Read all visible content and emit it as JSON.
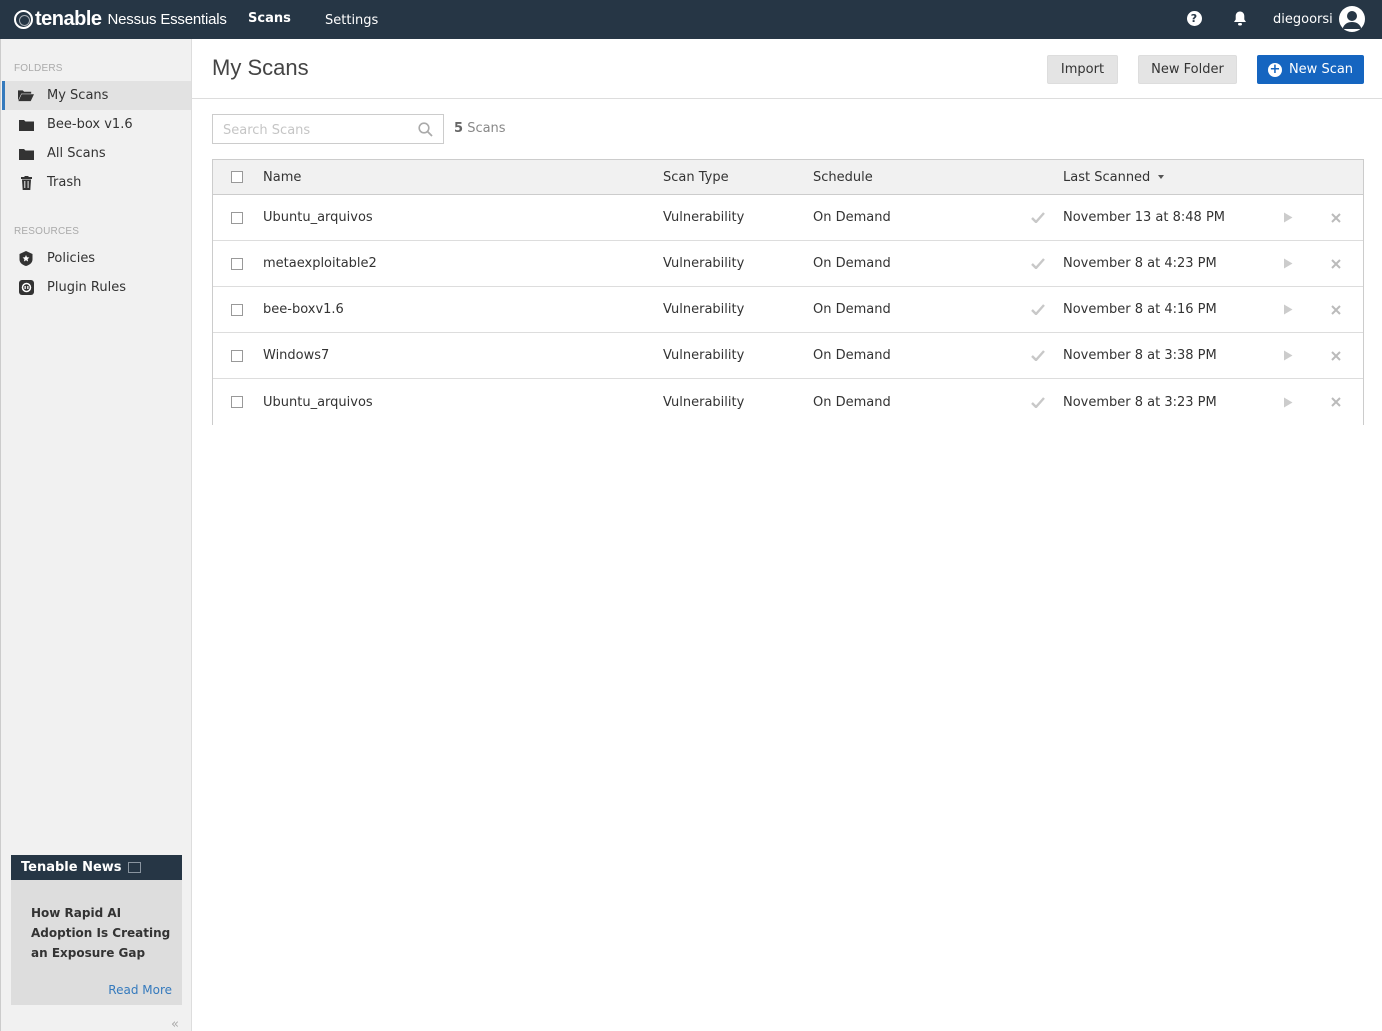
{
  "app": {
    "brand": "tenable",
    "product": "Nessus Essentials"
  },
  "nav": {
    "scans": "Scans",
    "settings": "Settings"
  },
  "user": {
    "name": "diegoorsi"
  },
  "sidebar": {
    "folders_heading": "FOLDERS",
    "folders": [
      {
        "label": "My Scans",
        "icon": "folder-open-icon",
        "active": true
      },
      {
        "label": "Bee-box v1.6",
        "icon": "folder-icon"
      },
      {
        "label": "All Scans",
        "icon": "folder-icon"
      },
      {
        "label": "Trash",
        "icon": "trash-icon"
      }
    ],
    "resources_heading": "RESOURCES",
    "resources": [
      {
        "label": "Policies",
        "icon": "policy-badge-icon"
      },
      {
        "label": "Plugin Rules",
        "icon": "plugin-rules-icon"
      }
    ]
  },
  "news": {
    "title": "Tenable News",
    "headline": "How Rapid AI Adoption Is Creating an Exposure Gap",
    "read_more": "Read More"
  },
  "main": {
    "title": "My Scans",
    "import_label": "Import",
    "new_folder_label": "New Folder",
    "new_scan_label": "New Scan",
    "search_placeholder": "Search Scans",
    "count_number": "5",
    "count_label": "Scans"
  },
  "table": {
    "columns": {
      "name": "Name",
      "type": "Scan Type",
      "schedule": "Schedule",
      "last": "Last Scanned"
    },
    "rows": [
      {
        "name": "Ubuntu_arquivos",
        "type": "Vulnerability",
        "schedule": "On Demand",
        "last": "November 13 at 8:48 PM"
      },
      {
        "name": "metaexploitable2",
        "type": "Vulnerability",
        "schedule": "On Demand",
        "last": "November 8 at 4:23 PM"
      },
      {
        "name": "bee-boxv1.6",
        "type": "Vulnerability",
        "schedule": "On Demand",
        "last": "November 8 at 4:16 PM"
      },
      {
        "name": "Windows7",
        "type": "Vulnerability",
        "schedule": "On Demand",
        "last": "November 8 at 3:38 PM"
      },
      {
        "name": "Ubuntu_arquivos",
        "type": "Vulnerability",
        "schedule": "On Demand",
        "last": "November 8 at 3:23 PM"
      }
    ]
  },
  "colors": {
    "topbar": "#263645",
    "accent": "#1565c0",
    "active_border": "#357abd"
  }
}
